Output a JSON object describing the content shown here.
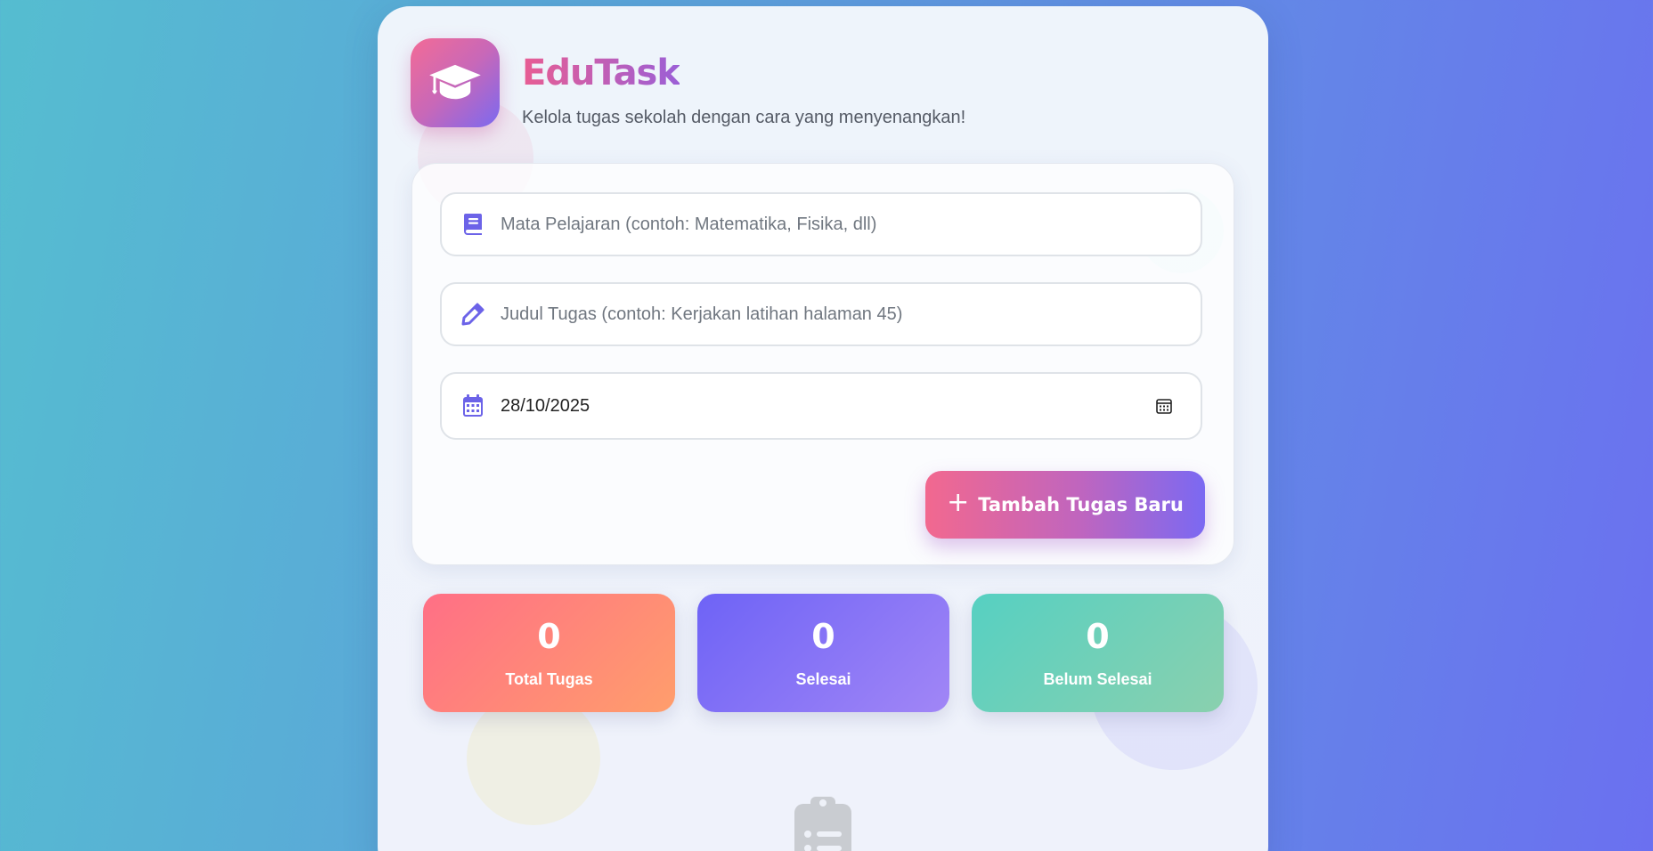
{
  "header": {
    "title": "EduTask",
    "subtitle": "Kelola tugas sekolah dengan cara yang menyenangkan!",
    "logo_icon": "graduation-cap-icon"
  },
  "form": {
    "subject": {
      "placeholder": "Mata Pelajaran (contoh: Matematika, Fisika, dll)",
      "value": "",
      "icon": "book-icon"
    },
    "task_title": {
      "placeholder": "Judul Tugas (contoh: Kerjakan latihan halaman 45)",
      "value": "",
      "icon": "pencil-icon"
    },
    "due_date": {
      "value": "28/10/2025",
      "icon": "calendar-icon",
      "picker_icon": "calendar-picker-icon"
    },
    "submit_label": "Tambah Tugas Baru",
    "submit_icon": "plus-icon"
  },
  "stats": {
    "total": {
      "value": "0",
      "label": "Total Tugas"
    },
    "done": {
      "value": "0",
      "label": "Selesai"
    },
    "pending": {
      "value": "0",
      "label": "Belum Selesai"
    }
  },
  "empty_state": {
    "icon": "clipboard-list-icon"
  },
  "colors": {
    "accent_pink": "#f2688f",
    "accent_purple": "#7b69f2",
    "icon_purple": "#6c63e8",
    "stat_total": "#ff6f86",
    "stat_done": "#6e63f6",
    "stat_pending": "#56d0c2"
  }
}
